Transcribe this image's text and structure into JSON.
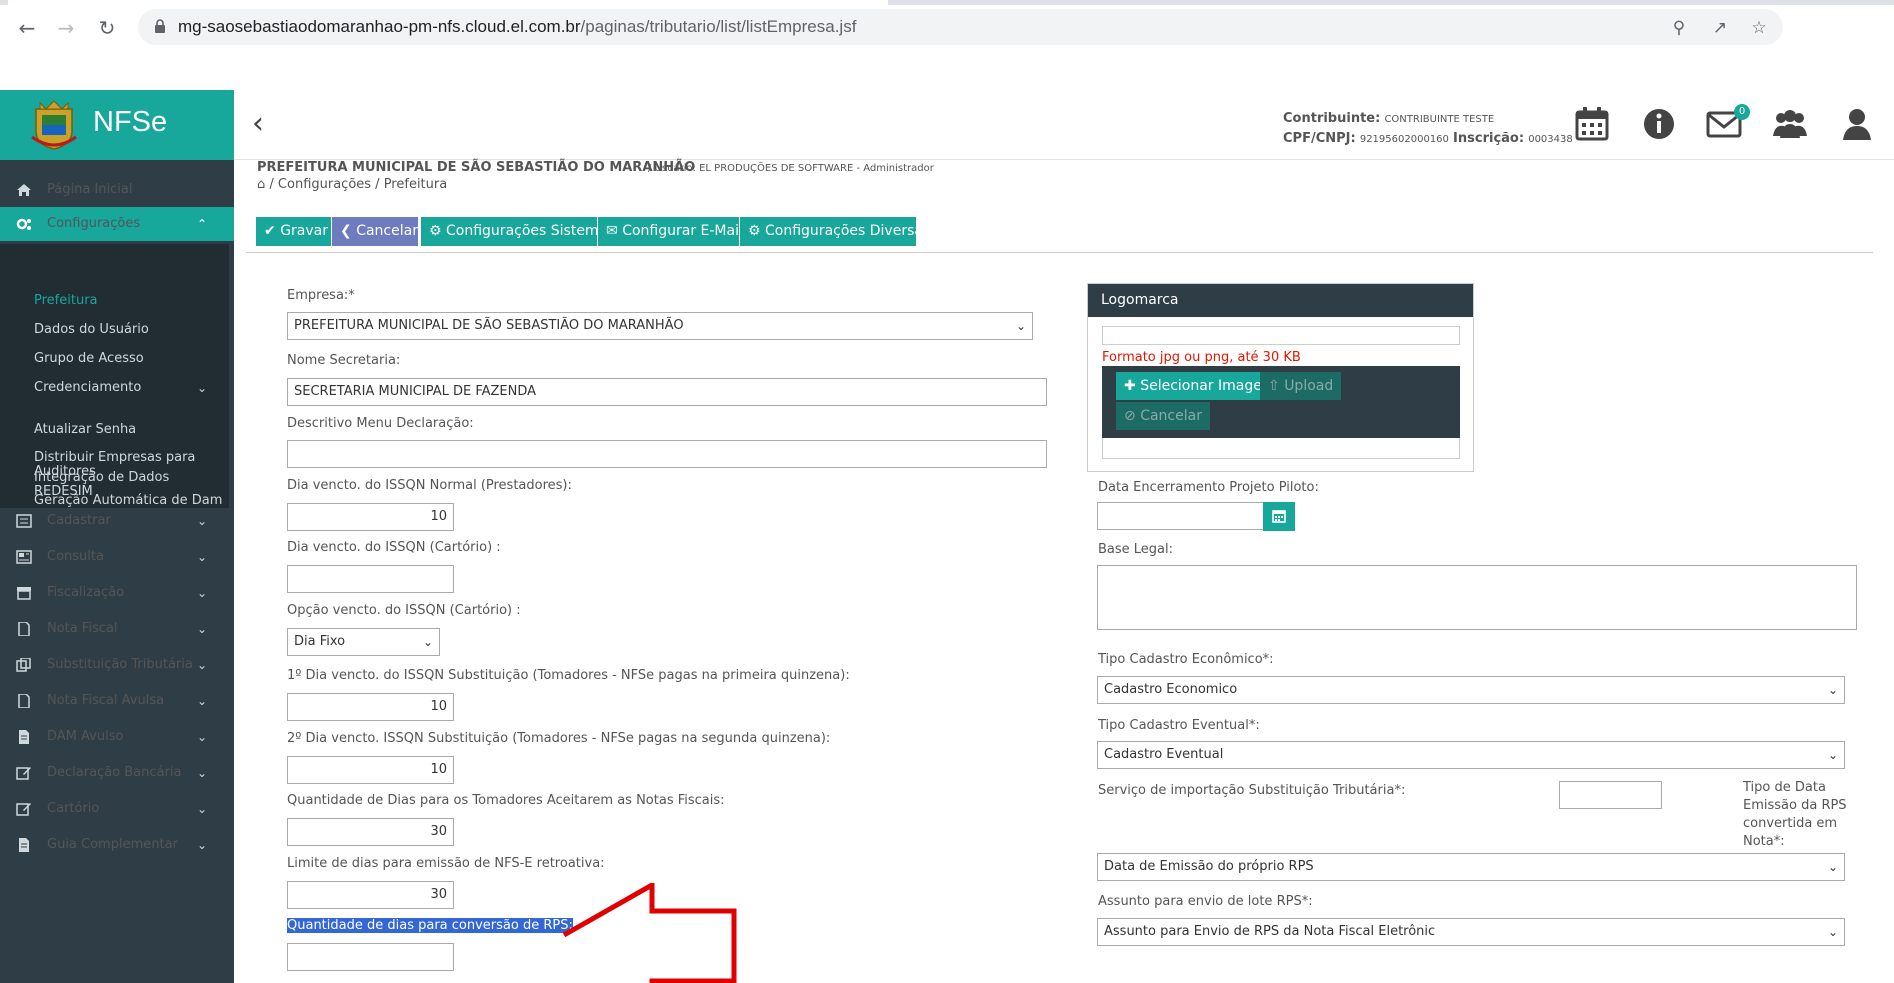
{
  "browser": {
    "url_host": "mg-saosebastiaodomaranhao-pm-nfs.cloud.el.com.br",
    "url_path": "/paginas/tributario/list/listEmpresa.jsf"
  },
  "brand": {
    "name": "NFSe"
  },
  "sidebar": {
    "pagina_inicial": "Página Inicial",
    "configuracoes": "Configurações",
    "sub": {
      "prefeitura": "Prefeitura",
      "dados_usuario": "Dados do Usuário",
      "grupo_acesso": "Grupo de Acesso",
      "credenciamento": "Credenciamento",
      "atualizar_senha": "Atualizar Senha",
      "distribuir_1": "Distribuir Empresas para",
      "distribuir_2": "Auditores",
      "geracao_dam": "Geração Automática de Dam",
      "integracao_1": "Integração de Dados",
      "integracao_2": "REDESIM"
    },
    "items": [
      "Cadastrar",
      "Consulta",
      "Fiscalização",
      "Nota Fiscal",
      "Substituição Tributária",
      "Nota Fiscal Avulsa",
      "DAM Avulso",
      "Declaração Bancária",
      "Cartório",
      "Guia Complementar"
    ]
  },
  "header": {
    "contribuinte_label": "Contribuinte:",
    "contribuinte_value": "CONTRIBUINTE TESTE",
    "cpf_label": "CPF/CNPJ:",
    "cpf_value": "92195602000160",
    "inscricao_label": "Inscrição:",
    "inscricao_value": "0003438",
    "mail_badge": "0"
  },
  "breadcrumb": {
    "org": "PREFEITURA MUNICIPAL DE SÃO SEBASTIÃO DO MARANHÃO",
    "user": "/ Usuário: EL PRODUÇÕES DE SOFTWARE - Administrador",
    "path": "/ Configurações / Prefeitura"
  },
  "toolbar": {
    "gravar": "Gravar",
    "cancelar": "Cancelar",
    "config_sistema": "Configurações Sistema",
    "config_email": "Configurar E-Mail",
    "config_diversas": "Configurações Diversas"
  },
  "form": {
    "empresa_label": "Empresa:*",
    "empresa_value": "PREFEITURA MUNICIPAL DE SÃO SEBASTIÃO DO MARANHÃO",
    "nome_secretaria_label": "Nome Secretaria:",
    "nome_secretaria_value": "SECRETARIA MUNICIPAL DE FAZENDA",
    "descritivo_label": "Descritivo Menu Declaração:",
    "descritivo_value": "",
    "dia_normal_label": "Dia vencto. do ISSQN Normal (Prestadores):",
    "dia_normal_value": "10",
    "dia_cartorio_label": "Dia vencto. do ISSQN (Cartório) :",
    "dia_cartorio_value": "",
    "opcao_cartorio_label": "Opção vencto. do ISSQN (Cartório) :",
    "opcao_cartorio_value": "Dia Fixo",
    "dia1_subst_label": "1º Dia vencto. do ISSQN Substituição (Tomadores - NFSe pagas na primeira quinzena):",
    "dia1_subst_value": "10",
    "dia2_subst_label": "2º Dia vencto. ISSQN Substituição (Tomadores - NFSe pagas na segunda quinzena):",
    "dia2_subst_value": "10",
    "qtd_dias_aceitar_label": "Quantidade de Dias para os Tomadores Aceitarem as Notas Fiscais:",
    "qtd_dias_aceitar_value": "30",
    "limite_retro_label": "Limite de dias para emissão de NFS-E retroativa:",
    "limite_retro_value": "30",
    "qtd_rps_label": "Quantidade de dias para conversão de RPS:",
    "qtd_rps_value": ""
  },
  "logo": {
    "title": "Logomarca",
    "hint": "Formato jpg ou png, até 30 KB",
    "select": "Selecionar Imagem",
    "upload": "Upload",
    "cancel": "Cancelar"
  },
  "right": {
    "data_encerramento_label": "Data Encerramento Projeto Piloto:",
    "data_encerramento_value": "",
    "base_legal_label": "Base Legal:",
    "base_legal_value": "",
    "tipo_cad_eco_label": "Tipo Cadastro Econômico*:",
    "tipo_cad_eco_value": "Cadastro Economico",
    "tipo_cad_event_label": "Tipo Cadastro Eventual*:",
    "tipo_cad_event_value": "Cadastro Eventual",
    "servico_import_label": "Serviço de importação Substituição Tributária*:",
    "servico_import_value": "",
    "tipo_data_label_1": "Tipo de Data",
    "tipo_data_label_2": "Emissão da RPS",
    "tipo_data_label_3": "convertida em",
    "tipo_data_label_4": "Nota*:",
    "tipo_data_value": "Data de Emissão do próprio RPS",
    "assunto_label": "Assunto para envio de lote RPS*:",
    "assunto_value": "Assunto para Envio de RPS da Nota Fiscal Eletrônic"
  },
  "colors": {
    "accent": "#17a79b",
    "sidebar": "#2f3d47",
    "subnav": "#222c33",
    "purple": "#6e7cbf",
    "error": "#e51400"
  }
}
